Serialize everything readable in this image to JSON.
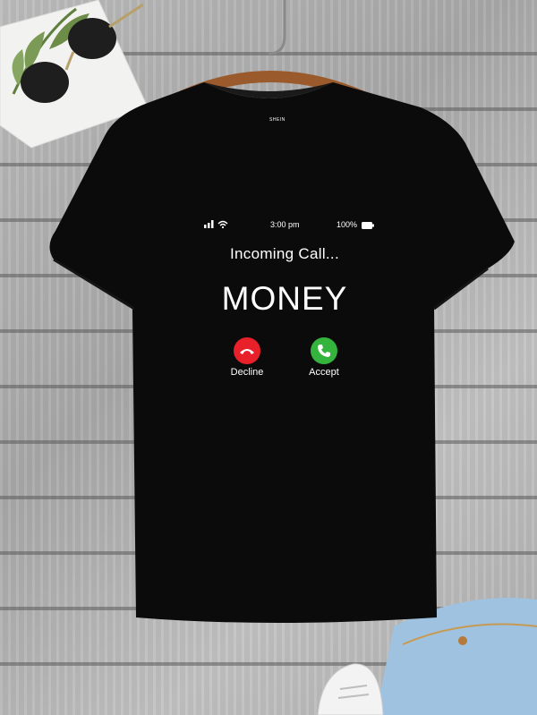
{
  "brand_tag": "SHEIN",
  "status_bar": {
    "time": "3:00 pm",
    "battery": "100%",
    "icons": [
      "signal-icon",
      "wifi-icon",
      "battery-icon"
    ]
  },
  "call": {
    "heading": "Incoming Call...",
    "caller": "MONEY",
    "decline_label": "Decline",
    "accept_label": "Accept"
  },
  "colors": {
    "shirt": "#0b0b0b",
    "decline": "#e8202a",
    "accept": "#34b33d",
    "text": "#ffffff"
  }
}
